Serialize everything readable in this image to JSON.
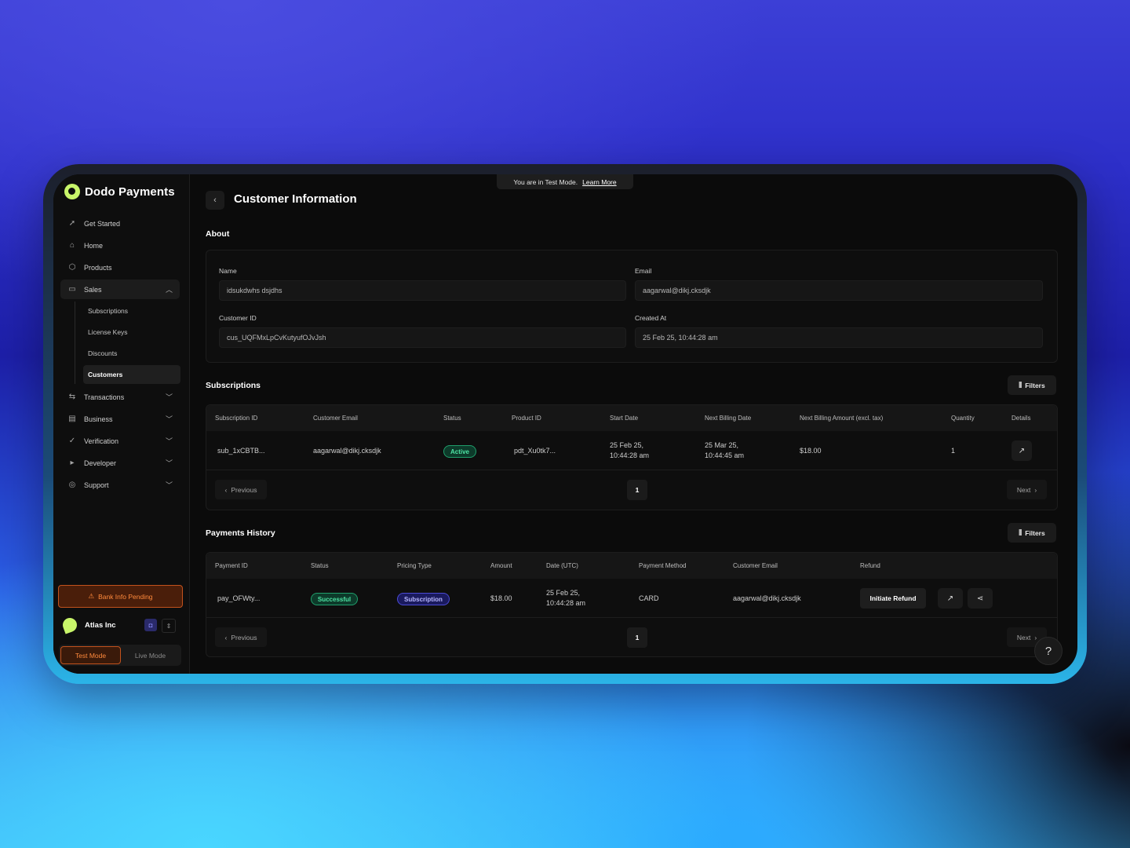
{
  "brand": {
    "name": "Dodo Payments"
  },
  "banner": {
    "text": "You are in Test Mode.",
    "link": "Learn More"
  },
  "sidebar": {
    "items": [
      {
        "label": "Get Started",
        "icon": "rocket-icon"
      },
      {
        "label": "Home",
        "icon": "home-icon"
      },
      {
        "label": "Products",
        "icon": "box-icon"
      },
      {
        "label": "Sales",
        "icon": "cash-icon"
      },
      {
        "label": "Transactions",
        "icon": "arrows-icon"
      },
      {
        "label": "Business",
        "icon": "store-icon"
      },
      {
        "label": "Verification",
        "icon": "check-circle-icon"
      },
      {
        "label": "Developer",
        "icon": "terminal-icon"
      },
      {
        "label": "Support",
        "icon": "lifebuoy-icon"
      }
    ],
    "sales_sub": [
      "Subscriptions",
      "License Keys",
      "Discounts",
      "Customers"
    ],
    "bank_warning": "Bank Info Pending",
    "org_name": "Atlas Inc",
    "modes": [
      "Test Mode",
      "Live Mode"
    ]
  },
  "page": {
    "title": "Customer Information"
  },
  "about": {
    "heading": "About",
    "name_label": "Name",
    "name_value": "idsukdwhs dsjdhs",
    "email_label": "Email",
    "email_value": "aagarwal@dikj.cksdjk",
    "id_label": "Customer ID",
    "id_value": "cus_UQFMxLpCvKutyufOJvJsh",
    "created_label": "Created At",
    "created_value": "25 Feb 25, 10:44:28 am"
  },
  "subscriptions": {
    "heading": "Subscriptions",
    "filters": "Filters",
    "columns": [
      "Subscription ID",
      "Customer Email",
      "Status",
      "Product ID",
      "Start Date",
      "Next Billing Date",
      "Next Billing Amount (excl. tax)",
      "Quantity",
      "Details"
    ],
    "row": {
      "id": "sub_1xCBTB...",
      "email": "aagarwal@dikj.cksdjk",
      "status": "Active",
      "product": "pdt_Xu0tk7...",
      "start_1": "25 Feb 25,",
      "start_2": "10:44:28 am",
      "next_1": "25 Mar 25,",
      "next_2": "10:44:45 am",
      "amount": "$18.00",
      "quantity": "1"
    },
    "prev": "Previous",
    "next": "Next",
    "page": "1"
  },
  "payments": {
    "heading": "Payments History",
    "filters": "Filters",
    "columns": [
      "Payment ID",
      "Status",
      "Pricing Type",
      "Amount",
      "Date (UTC)",
      "Payment Method",
      "Customer Email",
      "Refund"
    ],
    "row": {
      "id": "pay_OFWty...",
      "status": "Successful",
      "pricing": "Subscription",
      "amount": "$18.00",
      "date_1": "25 Feb 25,",
      "date_2": "10:44:28 am",
      "method": "CARD",
      "email": "aagarwal@dikj.cksdjk",
      "refund": "Initiate Refund"
    },
    "prev": "Previous",
    "next": "Next",
    "page": "1"
  },
  "help": "?",
  "colors": {
    "accent": "#c8f56a",
    "warning": "#ff8a3c",
    "success": "#4ee3a4",
    "info": "#b8b8ff"
  }
}
